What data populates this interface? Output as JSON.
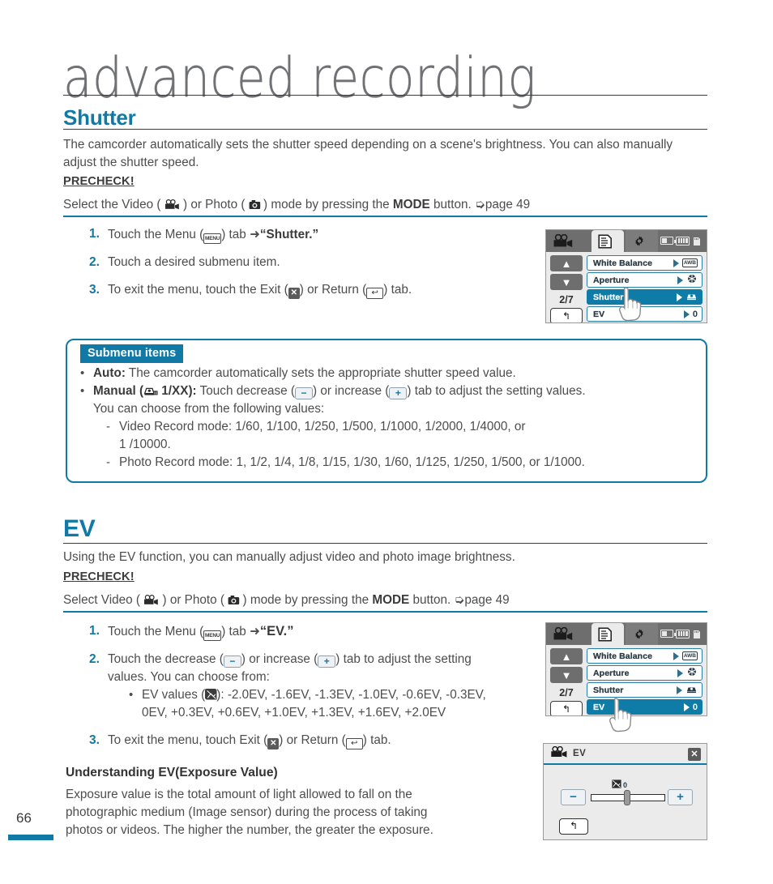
{
  "chapter": {
    "title": "advanced recording"
  },
  "page": {
    "number": "66"
  },
  "shutter": {
    "heading": "Shutter",
    "intro": "The camcorder automatically sets the shutter speed depending on a scene's brightness. You can also manually adjust the shutter speed.",
    "precheck_label": "PRECHECK!",
    "precheck_pre": "Select the Video (",
    "precheck_mid": ") or Photo (",
    "precheck_post": ") mode by pressing the ",
    "precheck_mode": "MODE",
    "precheck_tail": " button. ",
    "precheck_page": "page 49",
    "steps": [
      {
        "num": "1.",
        "pre": "Touch the Menu (",
        "icon": "menu-icon",
        "post": ") tab ",
        "arrow": "➜",
        "quoted": "“Shutter.”"
      },
      {
        "num": "2.",
        "text": "Touch a desired submenu item."
      },
      {
        "num": "3.",
        "pre": "To exit the menu, touch the Exit (",
        "mid": ") or Return (",
        "post": ") tab."
      }
    ]
  },
  "submenu_callout": {
    "tag": "Submenu items",
    "items": [
      {
        "bullet": "•",
        "label": "Auto:",
        "text": " The camcorder automatically sets the appropriate shutter speed value."
      },
      {
        "bullet": "•",
        "label_pre": "Manual (",
        "label_val": " 1/XX):",
        "text_a": " Touch decrease (",
        "text_b": ") or increase (",
        "text_c": ") tab to adjust the setting values.",
        "text_d": "You can choose from the following values:"
      }
    ],
    "sublines": [
      {
        "dash": "-",
        "text": "Video Record mode: 1/60, 1/100, 1/250, 1/500, 1/1000, 1/2000, 1/4000, or"
      },
      {
        "dash": "",
        "text": "1 /10000."
      },
      {
        "dash": "-",
        "text": "Photo Record mode: 1, 1/2, 1/4, 1/8, 1/15, 1/30, 1/60, 1/125, 1/250, 1/500, or 1/1000."
      }
    ]
  },
  "ev": {
    "heading": "EV",
    "intro": "Using the EV function, you can manually adjust video and photo image brightness.",
    "precheck_label": "PRECHECK!",
    "precheck_pre": "Select Video (",
    "precheck_mid": ") or Photo (",
    "precheck_post": ") mode by pressing the ",
    "precheck_mode": "MODE",
    "precheck_tail": " button. ",
    "precheck_page": "page 49",
    "step1": {
      "num": "1.",
      "pre": "Touch the Menu (",
      "post": ") tab ",
      "arrow": "➜",
      "quoted": "“EV.”"
    },
    "step2": {
      "num": "2.",
      "pre": "Touch the decrease (",
      "mid": ") or increase (",
      "post": ") tab to adjust the setting",
      "line2": "values. You can choose from:"
    },
    "step2_bullet": {
      "bullet": "•",
      "pre": "EV values (",
      "post": "): -2.0EV, -1.6EV, -1.3EV, -1.0EV, -0.6EV, -0.3EV,",
      "line2": "0EV, +0.3EV, +0.6EV, +1.0EV, +1.3EV, +1.6EV, +2.0EV"
    },
    "step3": {
      "num": "3.",
      "pre": "To exit the menu, touch Exit (",
      "mid": ") or Return (",
      "post": ") tab."
    },
    "understanding": {
      "heading": "Understanding EV(Exposure Value)",
      "lines": [
        "Exposure value is the total amount of light allowed to fall on the",
        "photographic medium (Image sensor) during the process of taking",
        "photos or videos. The higher the number, the greater the exposure."
      ]
    }
  },
  "lcd_shutter": {
    "camcorder_icon": "camcorder-icon",
    "tab_menu_icon": "menu-list-icon",
    "tab_settings_icon": "gear-icon",
    "status": [
      "battery-low-icon",
      "battery-full-icon",
      "memory-card-icon"
    ],
    "nav_up": "▲",
    "nav_down": "▼",
    "page_count": "2/7",
    "return": "↰",
    "rows": [
      {
        "label": "White Balance",
        "value_icon": "awb-icon",
        "value": "AWB",
        "selected": false
      },
      {
        "label": "Aperture",
        "value_icon": "aperture-icon",
        "value": "",
        "selected": false
      },
      {
        "label": "Shutter",
        "value_icon": "shutter-icon",
        "value": "",
        "selected": true
      },
      {
        "label": "EV",
        "value_icon": "",
        "value": "0",
        "selected": false
      }
    ]
  },
  "lcd_ev": {
    "page_count": "2/7",
    "nav_up": "▲",
    "nav_down": "▼",
    "return": "↰",
    "rows": [
      {
        "label": "White Balance",
        "value": "AWB",
        "selected": false
      },
      {
        "label": "Aperture",
        "value": "",
        "selected": false
      },
      {
        "label": "Shutter",
        "value": "",
        "selected": false
      },
      {
        "label": "EV",
        "value": "0",
        "selected": true
      }
    ]
  },
  "lcd_ev_adjust": {
    "title": "EV",
    "camcorder_icon": "camcorder-icon",
    "close": "✕",
    "minus": "−",
    "plus": "+",
    "value": "0",
    "return": "↰"
  }
}
